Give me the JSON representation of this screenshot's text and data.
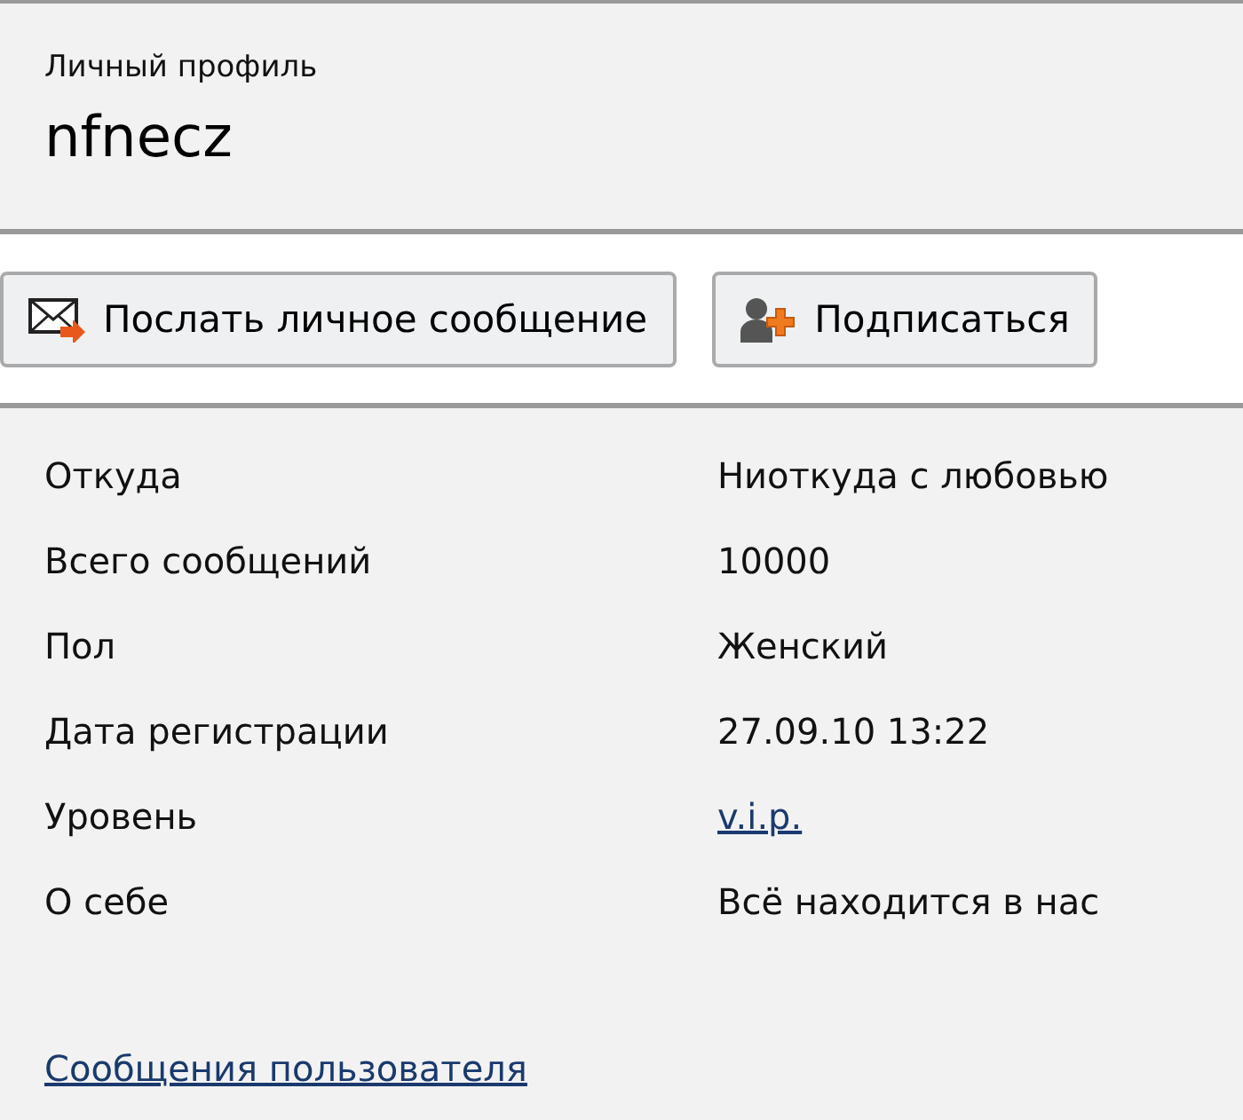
{
  "header": {
    "subtitle": "Личный профиль",
    "username": "nfnecz"
  },
  "actions": [
    {
      "kind": "message",
      "label": "Послать личное сообщение"
    },
    {
      "kind": "subscribe",
      "label": "Подписаться"
    }
  ],
  "fields": [
    {
      "label": "Откуда",
      "value": "Ниоткуда с любовью",
      "kind": "text"
    },
    {
      "label": "Всего сообщений",
      "value": "10000",
      "kind": "text"
    },
    {
      "label": "Пол",
      "value": "Женский",
      "kind": "text"
    },
    {
      "label": "Дата регистрации",
      "value": "27.09.10 13:22",
      "kind": "text"
    },
    {
      "label": "Уровень",
      "value": "v.i.p.",
      "kind": "link"
    },
    {
      "label": "О себе",
      "value": "Всё находится в нас",
      "kind": "text"
    }
  ],
  "footer_link": "Сообщения пользователя"
}
